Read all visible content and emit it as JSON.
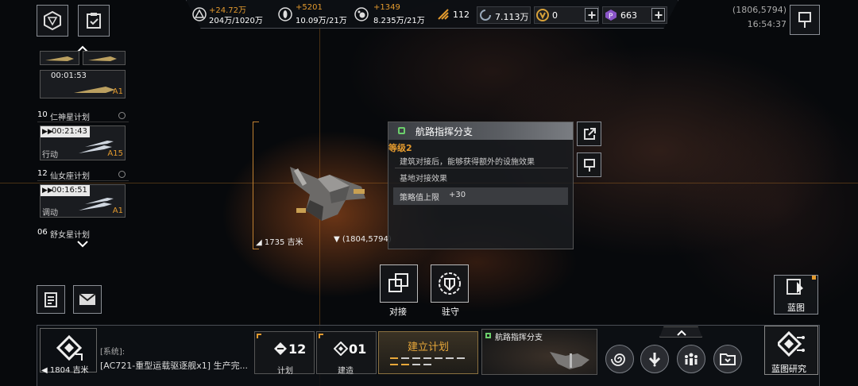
{
  "resources": {
    "r1": {
      "delta": "+24.72万",
      "value": "204万/1020万"
    },
    "r2": {
      "delta": "+5201",
      "value": "10.09万/21万"
    },
    "r3": {
      "delta": "+1349",
      "value": "8.235万/21万"
    },
    "r4": {
      "value": "112"
    },
    "r5": {
      "value": "7.113万"
    },
    "r6": {
      "value": "0"
    },
    "r7": {
      "value": "663"
    }
  },
  "coords": {
    "value": "(1806,5794)",
    "time": "16:54:37"
  },
  "sidebar": {
    "top_timer": "00:01:53",
    "top_badge": "A1",
    "tasks": [
      {
        "num": "10",
        "name": "仁神星计划",
        "timer": "00:21:43",
        "status": "行动",
        "badge": "A15"
      },
      {
        "num": "12",
        "name": "仙女座计划",
        "timer": "00:16:51",
        "status": "调动",
        "badge": "A1"
      },
      {
        "num": "06",
        "name": "舒女星计划"
      }
    ]
  },
  "target": {
    "distance": "1735 吉米",
    "coord": "(1804,5794)"
  },
  "info": {
    "title": "航路指挥分支",
    "level": "等级2",
    "desc": "建筑对接后，能够获得额外的设施效果",
    "section": "基地对接效果",
    "effect_label": "策略值上限",
    "effect_value": "+30"
  },
  "actions": {
    "dock": "对接",
    "garrison": "驻守"
  },
  "blueprint": {
    "label": "蓝图"
  },
  "bottom": {
    "distance": "1804 吉米",
    "log_tag": "[系统]:",
    "log_text": "[AC721-重型运载驱逐舰x1] 生产完...",
    "plan_count": "12",
    "plan_label": "计划",
    "build_count": "01",
    "build_label": "建造",
    "build_plan": "建立计划",
    "preview_title": "航路指挥分支",
    "research": "蓝图研究"
  }
}
